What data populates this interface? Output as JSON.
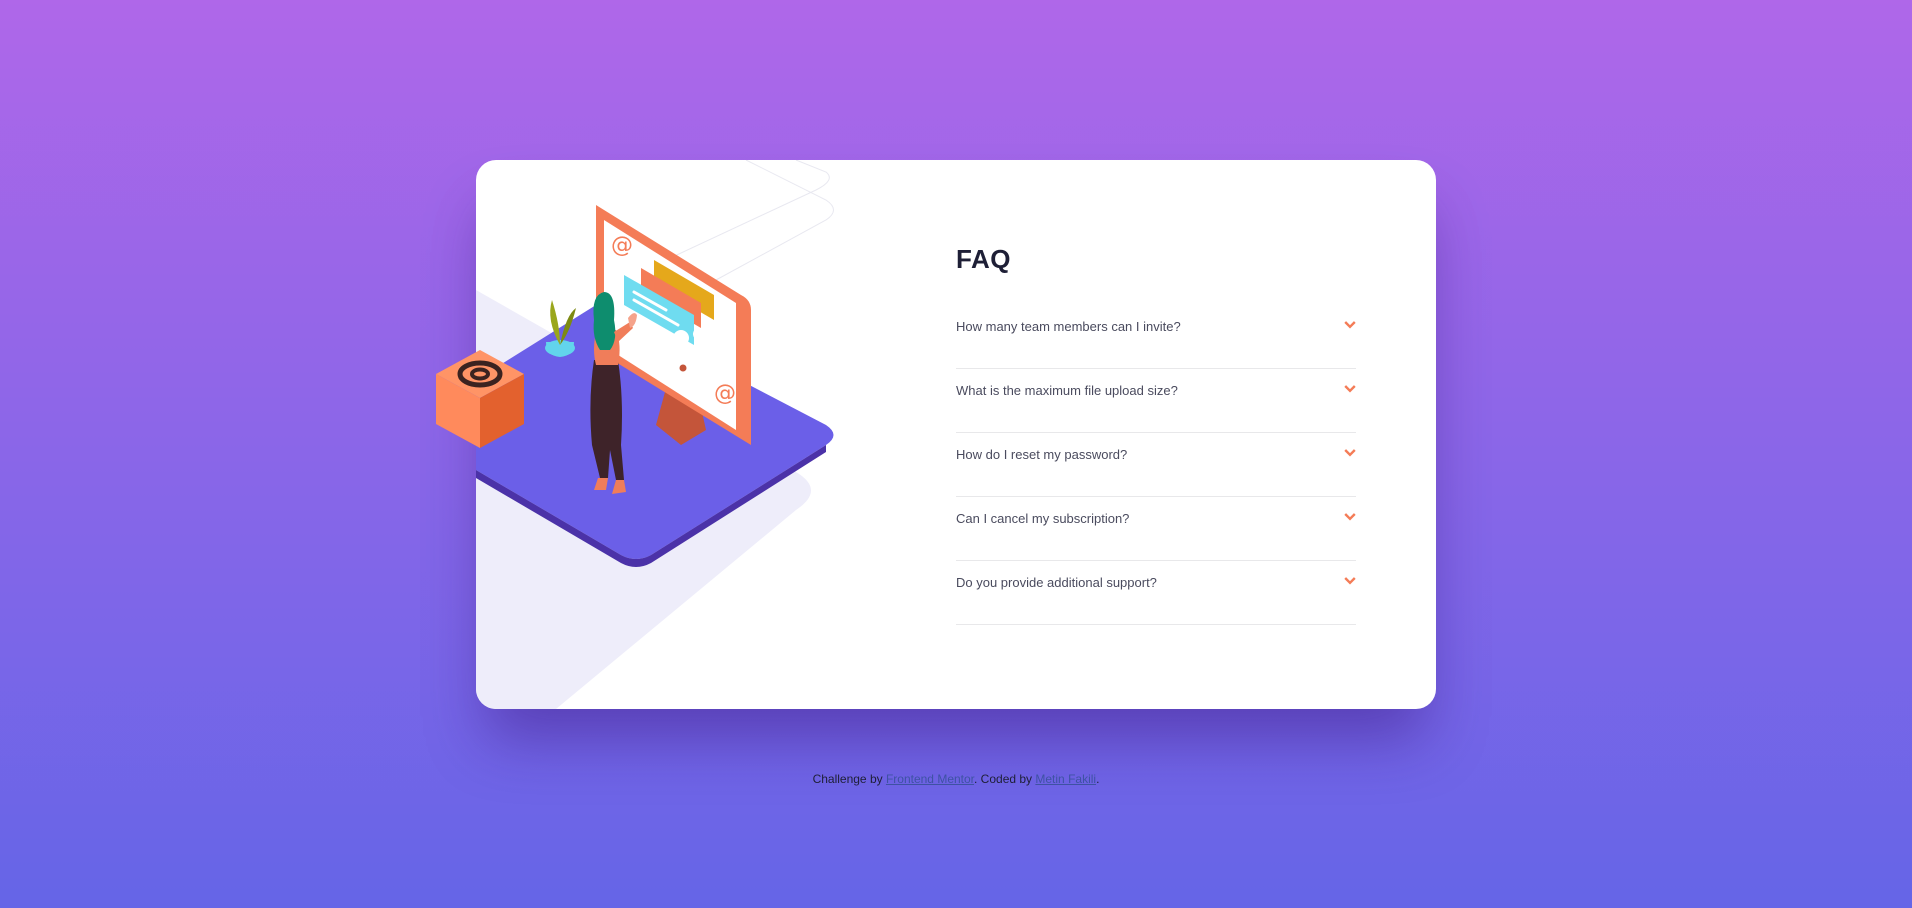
{
  "faq": {
    "title": "FAQ",
    "items": [
      {
        "question": "How many team members can I invite?",
        "icon": "chevron-down-icon"
      },
      {
        "question": "What is the maximum file upload size?",
        "icon": "chevron-down-icon"
      },
      {
        "question": "How do I reset my password?",
        "icon": "chevron-down-icon"
      },
      {
        "question": "Can I cancel my subscription?",
        "icon": "chevron-down-icon"
      },
      {
        "question": "Do you provide additional support?",
        "icon": "chevron-down-icon"
      }
    ]
  },
  "footer": {
    "prefix": "Challenge by ",
    "link1": "Frontend Mentor",
    "middle": ". Coded by ",
    "link2": "Metin Fakili",
    "suffix": "."
  },
  "colors": {
    "background_top": "#af67e9",
    "background_bottom": "#6565e7",
    "accent": "#f47c57",
    "title": "#1e1f36",
    "question": "#4a4b5e"
  }
}
